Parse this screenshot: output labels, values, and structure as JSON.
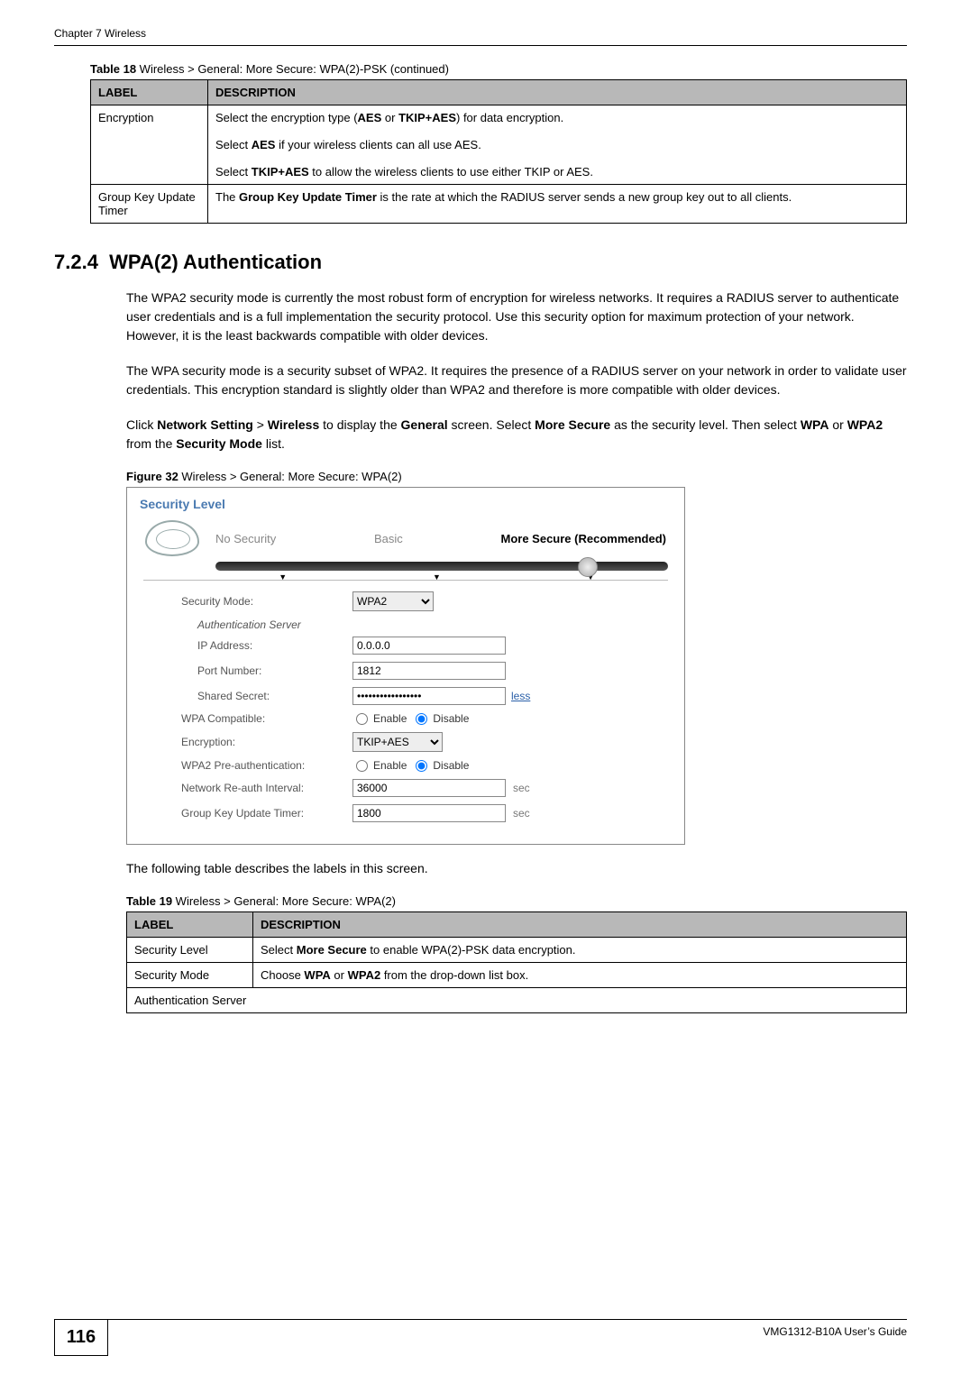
{
  "header": {
    "chapter": "Chapter 7 Wireless"
  },
  "table18": {
    "caption_prefix": "Table 18",
    "caption_rest": "   Wireless > General: More Secure: WPA(2)-PSK (continued)",
    "head_label": "LABEL",
    "head_desc": "DESCRIPTION",
    "rows": [
      {
        "label": "Encryption",
        "desc_line1_a": "Select the encryption type (",
        "desc_line1_b": "AES",
        "desc_line1_c": " or ",
        "desc_line1_d": "TKIP+AES",
        "desc_line1_e": ") for data encryption.",
        "desc_line2_a": "Select ",
        "desc_line2_b": "AES",
        "desc_line2_c": " if your wireless clients can all use AES.",
        "desc_line3_a": "Select ",
        "desc_line3_b": "TKIP+AES",
        "desc_line3_c": " to allow the wireless clients to use either TKIP or AES."
      },
      {
        "label": "Group Key Update Timer",
        "desc_a": "The ",
        "desc_b": "Group Key Update Timer",
        "desc_c": " is the rate at which the RADIUS server sends a new group key out to all clients."
      }
    ]
  },
  "section": {
    "number": "7.2.4",
    "title": "WPA(2) Authentication",
    "para1": "The WPA2 security mode is currently the most robust form of encryption for wireless networks. It requires a RADIUS server to authenticate user credentials and is a full implementation the security protocol. Use this security option for maximum protection of your network. However, it is the least backwards compatible with older devices.",
    "para2": "The WPA security mode is a security subset of WPA2. It requires the presence of a RADIUS server on your network in order to validate user credentials. This encryption standard is slightly older than WPA2 and therefore is more compatible with older devices.",
    "para3_a": "Click ",
    "para3_b": "Network Setting",
    "para3_c": " > ",
    "para3_d": "Wireless",
    "para3_e": " to display the ",
    "para3_f": "General",
    "para3_g": " screen. Select ",
    "para3_h": "More Secure",
    "para3_i": " as the security level. Then select ",
    "para3_j": "WPA",
    "para3_k": " or ",
    "para3_l": "WPA2",
    "para3_m": " from the ",
    "para3_n": "Security Mode",
    "para3_o": " list."
  },
  "figure": {
    "caption_prefix": "Figure 32",
    "caption_rest": "   Wireless > General: More Secure: WPA(2)",
    "panel_title": "Security Level",
    "levels": {
      "none": "No Security",
      "basic": "Basic",
      "more": "More Secure (Recommended)"
    },
    "form": {
      "security_mode_label": "Security Mode:",
      "security_mode_value": "WPA2",
      "auth_server_header": "Authentication Server",
      "ip_label": "IP Address:",
      "ip_value": "0.0.0.0",
      "port_label": "Port Number:",
      "port_value": "1812",
      "secret_label": "Shared Secret:",
      "secret_value": "•••••••••••••••••",
      "less_link": "less",
      "wpa_compat_label": "WPA Compatible:",
      "enable": "Enable",
      "disable": "Disable",
      "encryption_label": "Encryption:",
      "encryption_value": "TKIP+AES",
      "preauth_label": "WPA2 Pre-authentication:",
      "reauth_label": "Network Re-auth Interval:",
      "reauth_value": "36000",
      "group_key_label": "Group Key Update Timer:",
      "group_key_value": "1800",
      "unit_sec": "sec"
    }
  },
  "post_figure_text": "The following table describes the labels in this screen.",
  "table19": {
    "caption_prefix": "Table 19",
    "caption_rest": "   Wireless > General: More Secure: WPA(2)",
    "head_label": "LABEL",
    "head_desc": "DESCRIPTION",
    "rows": {
      "r1_label": "Security Level",
      "r1_a": "Select ",
      "r1_b": "More Secure",
      "r1_c": " to enable WPA(2)-PSK data encryption.",
      "r2_label": "Security Mode",
      "r2_a": "Choose ",
      "r2_b": "WPA",
      "r2_c": " or ",
      "r2_d": "WPA2",
      "r2_e": " from the drop-down list box.",
      "r3_label": "Authentication Server"
    }
  },
  "footer": {
    "page": "116",
    "guide": "VMG1312-B10A User’s Guide"
  }
}
